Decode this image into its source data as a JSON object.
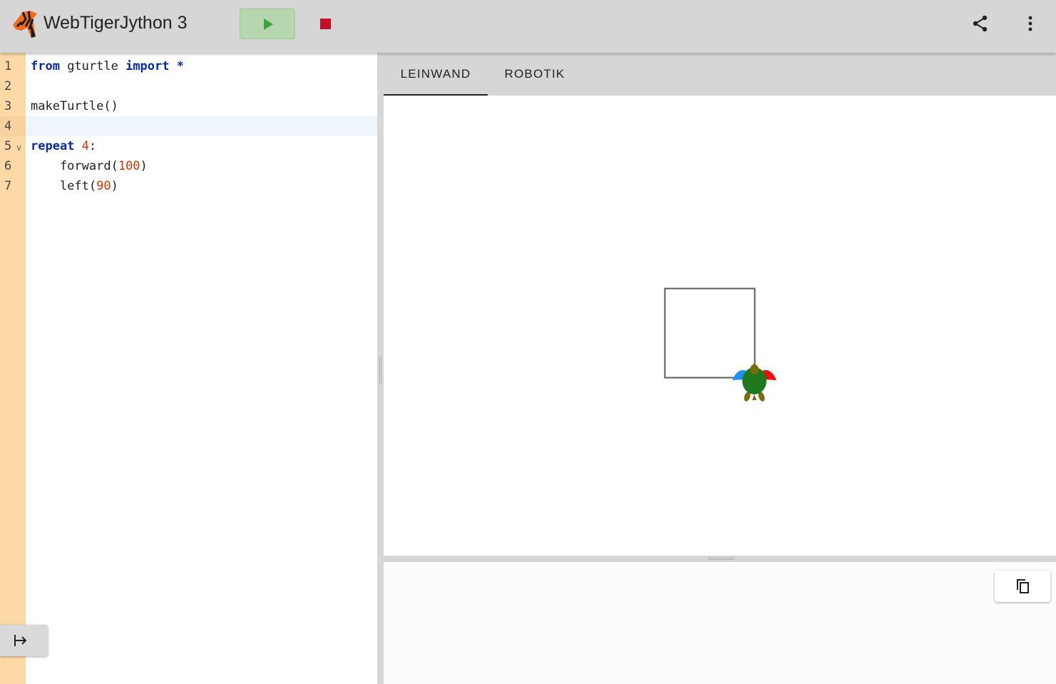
{
  "app": {
    "title": "WebTigerJython 3"
  },
  "toolbar": {
    "run_icon": "play-icon",
    "stop_icon": "stop-icon",
    "share_icon": "share-icon",
    "menu_icon": "more-vert-icon"
  },
  "editor": {
    "lines": [
      {
        "num": "1",
        "tokens": [
          {
            "t": "from",
            "c": "kw"
          },
          {
            "t": " gturtle ",
            "c": ""
          },
          {
            "t": "import",
            "c": "kw"
          },
          {
            "t": " ",
            "c": ""
          },
          {
            "t": "*",
            "c": "kw"
          }
        ]
      },
      {
        "num": "2",
        "tokens": []
      },
      {
        "num": "3",
        "tokens": [
          {
            "t": "makeTurtle()",
            "c": ""
          }
        ]
      },
      {
        "num": "4",
        "tokens": []
      },
      {
        "num": "5",
        "tokens": [
          {
            "t": "repeat",
            "c": "kw"
          },
          {
            "t": " ",
            "c": ""
          },
          {
            "t": "4",
            "c": "num"
          },
          {
            "t": ":",
            "c": ""
          }
        ]
      },
      {
        "num": "6",
        "tokens": [
          {
            "t": "    forward(",
            "c": ""
          },
          {
            "t": "100",
            "c": "num"
          },
          {
            "t": ")",
            "c": ""
          }
        ]
      },
      {
        "num": "7",
        "tokens": [
          {
            "t": "    left(",
            "c": ""
          },
          {
            "t": "90",
            "c": "num"
          },
          {
            "t": ")",
            "c": ""
          }
        ]
      }
    ],
    "active_line": "4",
    "fold_marker": "v",
    "collapse_icon": "arrow-right-to-bar-icon"
  },
  "tabs": [
    {
      "label": "LEINWAND",
      "active": true
    },
    {
      "label": "ROBOTIK",
      "active": false
    }
  ],
  "output": {
    "copy_icon": "copy-icon",
    "text": ""
  },
  "colors": {
    "gutter": "#fdd9a6",
    "keyword": "#0b2b9c",
    "number": "#c0390b",
    "run": "#b6d6b0",
    "stop": "#c0102a"
  }
}
